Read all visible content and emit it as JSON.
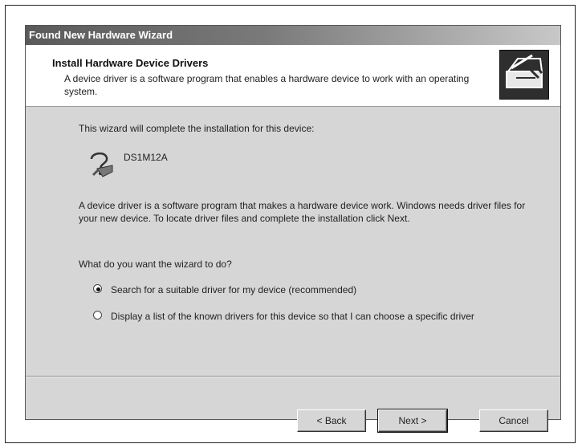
{
  "window": {
    "title": "Found New Hardware Wizard"
  },
  "header": {
    "title": "Install Hardware Device Drivers",
    "description": "A device driver is a software program that enables a hardware device to work with an operating system.",
    "icon": "hardware-install-icon"
  },
  "body": {
    "intro": "This wizard will complete the installation for this device:",
    "device": {
      "icon": "unknown-device-icon",
      "name": "DS1M12A"
    },
    "explanation": "A device driver is a software program that makes a hardware device work. Windows needs driver files for your new device. To locate driver files and complete the installation click Next.",
    "question": "What do you want the wizard to do?",
    "options": [
      {
        "label": "Search for a suitable driver for my device (recommended)",
        "selected": true
      },
      {
        "label": "Display a list of the known drivers for this device so that I can choose a specific driver",
        "selected": false
      }
    ]
  },
  "buttons": {
    "back": "< Back",
    "next": "Next >",
    "cancel": "Cancel"
  }
}
